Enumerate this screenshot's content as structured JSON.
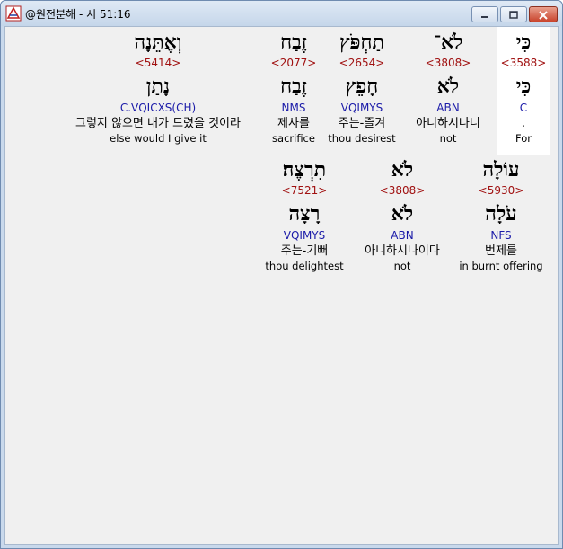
{
  "window": {
    "title": "@원전분해 - 시 51:16"
  },
  "line1": [
    {
      "hebrew": "כִּי",
      "strong": "<3588>",
      "root": "כִּי",
      "parse": "C",
      "korean": ".",
      "english": "For"
    },
    {
      "hebrew": "לֹא־",
      "strong": "<3808>",
      "root": "לֹא",
      "parse": "ABN",
      "korean": "아니하시나니",
      "english": "not"
    },
    {
      "hebrew": "תַחְפֹּץ",
      "strong": "<2654>",
      "root": "חָפֵץ",
      "parse": "VQIMYS",
      "korean": "주는-즐겨",
      "english": "thou desirest"
    },
    {
      "hebrew": "זֶבַח",
      "strong": "<2077>",
      "root": "זֶבַח",
      "parse": "NMS",
      "korean": "제사를",
      "english": "sacrifice"
    },
    {
      "hebrew": "וְאֶתֵּנָה",
      "strong": "<5414>",
      "root": "נָתַן",
      "parse": "C.VQICXS(CH)",
      "korean": "그렇지 않으면 내가 드렸을 것이라",
      "english": "else would I give it"
    }
  ],
  "line2": [
    {
      "hebrew": "עוֹלָה",
      "strong": "<5930>",
      "root": "עֹלָה",
      "parse": "NFS",
      "korean": "번제를",
      "english": "in burnt offering"
    },
    {
      "hebrew": "לֹא",
      "strong": "<3808>",
      "root": "לֹא",
      "parse": "ABN",
      "korean": "아니하시나이다",
      "english": "not"
    },
    {
      "hebrew": "תִרְצֶה׃",
      "strong": "<7521>",
      "root": "רָצָה",
      "parse": "VQIMYS",
      "korean": "주는-기뻐",
      "english": "thou delightest"
    }
  ]
}
